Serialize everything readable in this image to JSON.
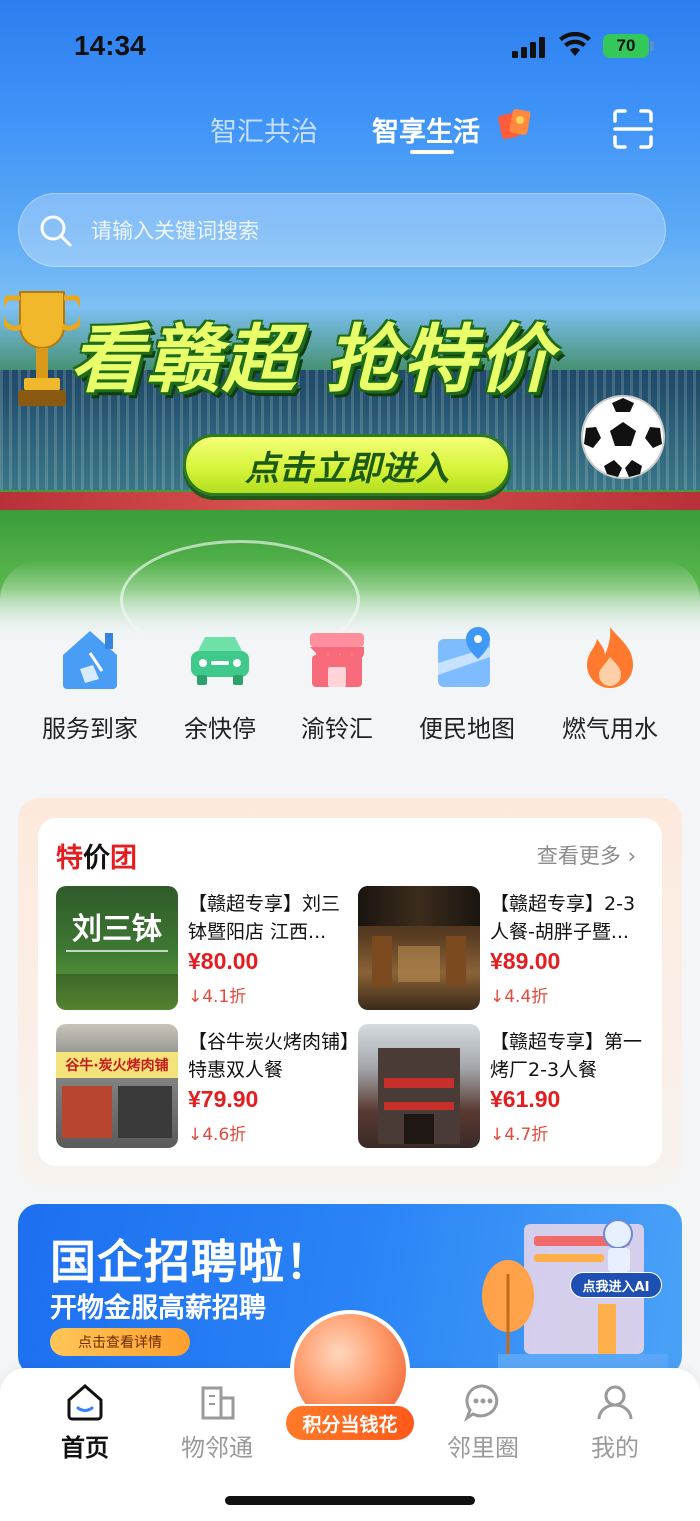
{
  "status_bar": {
    "time": "14:34",
    "battery": "70"
  },
  "header": {
    "tabs": [
      {
        "label": "智汇共治",
        "active": false
      },
      {
        "label": "智享生活",
        "active": true
      }
    ]
  },
  "search": {
    "placeholder": "请输入关键词搜索"
  },
  "banner": {
    "title": "看赣超  抢特价",
    "cta": "点击立即进入"
  },
  "services": [
    {
      "label": "服务到家",
      "icon": "house-broom-icon",
      "color": "#4a9df5"
    },
    {
      "label": "余快停",
      "icon": "car-icon",
      "color": "#3fc98a"
    },
    {
      "label": "渝铃汇",
      "icon": "shop-icon",
      "color": "#f66a7a"
    },
    {
      "label": "便民地图",
      "icon": "map-pin-icon",
      "color": "#3f98f5"
    },
    {
      "label": "燃气用水",
      "icon": "flame-icon",
      "color": "#ff7a2e"
    }
  ],
  "deals": {
    "title_parts": [
      "特",
      "价",
      "团"
    ],
    "see_more": "查看更多",
    "items": [
      {
        "name": "【赣超专享】刘三钵暨阳店 江西...",
        "price": "¥80.00",
        "discount": "↓4.1折",
        "thumb_text": "刘三钵"
      },
      {
        "name": "【赣超专享】2-3人餐-胡胖子暨...",
        "price": "¥89.00",
        "discount": "↓4.4折"
      },
      {
        "name": "【谷牛炭火烤肉铺】特惠双人餐",
        "price": "¥79.90",
        "discount": "↓4.6折",
        "thumb_text": "谷牛·炭火烤肉铺"
      },
      {
        "name": "【赣超专享】第一烤厂2-3人餐",
        "price": "¥61.90",
        "discount": "↓4.7折"
      }
    ]
  },
  "recruit": {
    "title": "国企招聘啦！",
    "subtitle": "开物金服高薪招聘",
    "button": "点击查看详情",
    "ai_label": "点我进入AI"
  },
  "bottom_nav": {
    "items": [
      {
        "label": "首页",
        "active": true
      },
      {
        "label": "物邻通",
        "active": false
      },
      {
        "label": "邻里圈",
        "active": false
      },
      {
        "label": "我的",
        "active": false
      }
    ],
    "center_label": "积分当钱花"
  }
}
